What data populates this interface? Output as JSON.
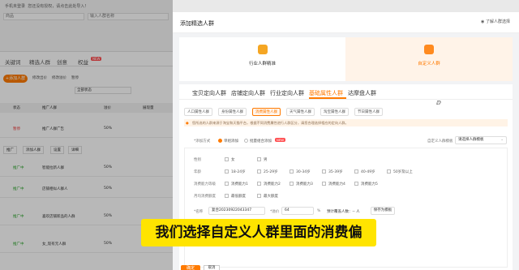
{
  "bg": {
    "top_line1": "手机未登录",
    "top_line2": "您还没有授权，请点击此处导入！",
    "filter1": "商品",
    "filter2": "输入人群名称",
    "tabs": [
      "关键词",
      "精选人群",
      "创意",
      "权益"
    ],
    "tab_badge": "NEW",
    "btn_add": "+添加人群",
    "btn2": "修改出价",
    "btn3": "修改溢价",
    "btn4": "暂停",
    "sel": "全部状态",
    "h1": "状态",
    "h2": "推广人群",
    "h3": "溢价",
    "h4": "展现量",
    "rows": [
      {
        "status": "暂停",
        "name": "推广人群广告",
        "pct": "50%"
      },
      {
        "status": "推广中",
        "name": "智能拉新人群",
        "pct": "50%"
      },
      {
        "status": "推广中",
        "name": "店铺相似人群人",
        "pct": "50%"
      },
      {
        "status": "推广中",
        "name": "喜欢店铺新品的人群",
        "pct": "50%"
      },
      {
        "status": "推广中",
        "name": "女_现有元人群",
        "pct": "50%"
      }
    ],
    "chips": [
      "推广",
      "添加人群",
      "设置",
      "详细"
    ]
  },
  "drawer": {
    "title": "添加精选人群",
    "help": "了解人群选择",
    "card1": "行业人群精准",
    "card2": "自定义人群",
    "main_tabs": [
      "宝贝定向人群",
      "店铺定向人群",
      "行业定向人群",
      "基础属性人群",
      "达摩盘人群"
    ],
    "sub_tabs": [
      "人口属性人群",
      "身份属性人群",
      "消费属性人群",
      "天气属性人群",
      "淘宝属性人群",
      "节日属性人群"
    ],
    "notice": "您所选的人群来源于淘宝和天猫平台，根据不同消费属性进行人群区分，请您合理选择相应的定向人群。",
    "mode_label": "*添加方式",
    "mode_single": "单组添加",
    "mode_batch": "批量组合添加",
    "mode_badge": "NEW",
    "name_label": "自定义人群模板",
    "name_value": "请选择人群模板",
    "gender_label": "性别",
    "gender_opts": [
      "女",
      "男"
    ],
    "age_label": "年龄",
    "age_opts": [
      "18-24岁",
      "25-29岁",
      "30-34岁",
      "35-39岁",
      "40-49岁",
      "50岁及以上"
    ],
    "spend_label": "消费能力等级",
    "spend_opts": [
      "消费能力1",
      "消费能力2",
      "消费能力3",
      "消费能力4",
      "消费能力5"
    ],
    "orders_label": "月均消费额度",
    "orders_opts": [
      "最低额度",
      "最大额度"
    ],
    "name_field_label": "*名称",
    "name_field": "复合20230922043347",
    "bid_label": "*溢价",
    "bid_value": "64",
    "bid_unit": "%",
    "cover_label": "预计覆盖人数：",
    "cover_value": "-- 人",
    "save_btn": "保存为模板",
    "ok_btn": "确定",
    "cancel_btn": "取消"
  },
  "caption": "我们选择自定义人群里面的消费偏",
  "colors": {
    "accent": "#ff7a00",
    "caption_bg": "#ffe400"
  }
}
